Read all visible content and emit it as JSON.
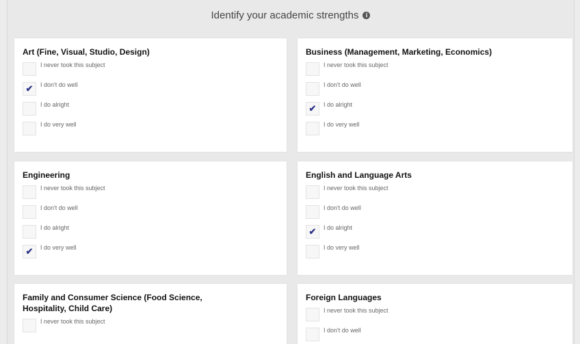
{
  "page": {
    "title": "Identify your academic strengths"
  },
  "cards": [
    {
      "title": "Art (Fine, Visual, Studio, Design)",
      "options": [
        {
          "label": "I never took this subject",
          "checked": false
        },
        {
          "label": "I don't do well",
          "checked": true
        },
        {
          "label": "I do alright",
          "checked": false
        },
        {
          "label": "I do very well",
          "checked": false
        }
      ]
    },
    {
      "title": "Business (Management, Marketing, Economics)",
      "options": [
        {
          "label": "I never took this subject",
          "checked": false
        },
        {
          "label": "I don't do well",
          "checked": false
        },
        {
          "label": "I do alright",
          "checked": true
        },
        {
          "label": "I do very well",
          "checked": false
        }
      ]
    },
    {
      "title": "Engineering",
      "options": [
        {
          "label": "I never took this subject",
          "checked": false
        },
        {
          "label": "I don't do well",
          "checked": false
        },
        {
          "label": "I do alright",
          "checked": false
        },
        {
          "label": "I do very well",
          "checked": true
        }
      ]
    },
    {
      "title": "English and Language Arts",
      "options": [
        {
          "label": "I never took this subject",
          "checked": false
        },
        {
          "label": "I don't do well",
          "checked": false
        },
        {
          "label": "I do alright",
          "checked": true
        },
        {
          "label": "I do very well",
          "checked": false
        }
      ]
    },
    {
      "title": "Family and Consumer Science (Food Science, Hospitality, Child Care)",
      "options": [
        {
          "label": "I never took this subject",
          "checked": false
        }
      ]
    },
    {
      "title": "Foreign Languages",
      "options": [
        {
          "label": "I never took this subject",
          "checked": false
        },
        {
          "label": "I don't do well",
          "checked": false
        }
      ]
    }
  ],
  "icons": {
    "info": "info-icon",
    "check": "checkmark-icon"
  },
  "colors": {
    "check": "#31368a",
    "background": "#e9e9e9",
    "card": "#ffffff"
  }
}
